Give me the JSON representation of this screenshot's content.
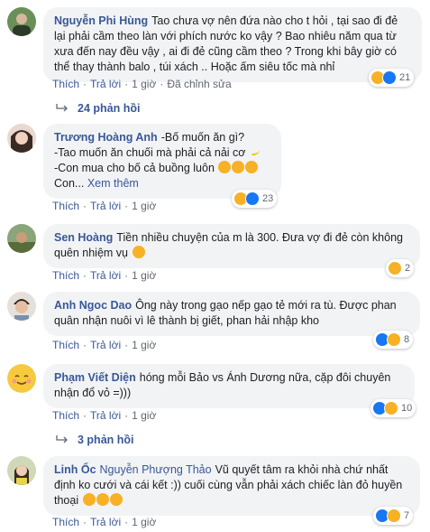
{
  "comments": [
    {
      "author": "Nguyễn Phi Hùng",
      "text": "Tao chưa vợ nên đứa nào cho t hỏi , tại sao đi đẻ lại phải cầm theo làn với phích nước ko vậy ? Bao nhiêu năm qua từ xưa đến nay đều vậy , ai đi đẻ cũng cầm theo ? Trong khi bây giờ có thể thay thành balo , túi xách .. Hoặc ấm siêu tốc mà nhỉ",
      "reactions": "21",
      "actions": {
        "like": "Thích",
        "reply": "Trả lời",
        "time": "1 giờ",
        "edited": "Đã chỉnh sửa"
      }
    },
    {
      "author": "Trương Hoàng Anh",
      "line1": "-Bố muốn ăn gì?",
      "line2": "-Tao muốn ăn chuối mà phải cả nải cơ",
      "line3": "-Con mua cho bố cả buồng luôn",
      "line4_prefix": "Con...",
      "see_more": "Xem thêm",
      "reactions": "23",
      "actions": {
        "like": "Thích",
        "reply": "Trả lời",
        "time": "1 giờ"
      }
    },
    {
      "author": "Sen Hoàng",
      "text": "Tiền nhiều chuyện của m là 300. Đưa vợ đi đẻ còn không quên nhiệm vụ",
      "reactions": "2",
      "actions": {
        "like": "Thích",
        "reply": "Trả lời",
        "time": "1 giờ"
      }
    },
    {
      "author": "Anh Ngoc Dao",
      "text": "Ông này trong gạo nếp gạo tẻ mới ra tù. Được phan quân nhận nuôi vì lê thành bị giết, phan hải nhập kho",
      "reactions": "8",
      "actions": {
        "like": "Thích",
        "reply": "Trả lời",
        "time": "1 giờ"
      }
    },
    {
      "author": "Phạm Viết Diện",
      "text": "hóng mỗi Bảo vs Ánh Dương nữa, cặp đôi chuyên nhận đổ vỏ =)))",
      "reactions": "10",
      "actions": {
        "like": "Thích",
        "reply": "Trả lời",
        "time": "1 giờ"
      }
    },
    {
      "author": "Linh Ốc",
      "mention": "Nguyễn Phượng Thảo",
      "text": "Vũ quyết tâm ra khỏi nhà chứ nhất định ko cưới và cái kết :)) cuối cùng vẫn phải xách chiếc làn đỏ huyền thoại",
      "reactions": "7",
      "actions": {
        "like": "Thích",
        "reply": "Trả lời",
        "time": "1 giờ"
      }
    }
  ],
  "reply_threads": [
    "24 phản hồi",
    "3 phản hồi"
  ],
  "colors": {
    "link": "#385898",
    "bubble": "#f2f3f5",
    "meta": "#606770",
    "haha": "#f7b125",
    "like": "#1877f2"
  }
}
